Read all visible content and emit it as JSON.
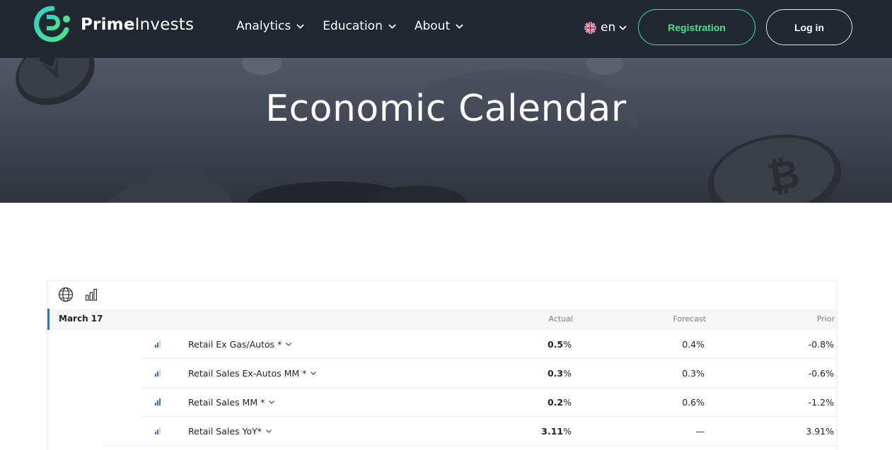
{
  "header": {
    "brand_bold": "Prime",
    "brand_rest": "Invests",
    "logo_icon": "prime-invests-logo",
    "nav": [
      {
        "label": "Analytics"
      },
      {
        "label": "Education"
      },
      {
        "label": "About"
      }
    ],
    "language": {
      "code": "en",
      "flag_icon": "uk-flag-icon"
    },
    "registration_label": "Registration",
    "login_label": "Log in"
  },
  "hero": {
    "title": "Economic Calendar"
  },
  "calendar": {
    "toolbar_icons": [
      "globe-icon",
      "bar-chart-icon"
    ],
    "date": "March 17",
    "columns": {
      "actual": "Actual",
      "forecast": "Forecast",
      "prior": "Prior"
    },
    "events": [
      {
        "name": "Retail Ex Gas/Autos *",
        "importance": 2,
        "actual": "0.5",
        "actual_unit": "%",
        "forecast": "0.4%",
        "prior": "-0.8%"
      },
      {
        "name": "Retail Sales Ex-Autos MM *",
        "importance": 2,
        "actual": "0.3",
        "actual_unit": "%",
        "forecast": "0.3%",
        "prior": "-0.6%"
      },
      {
        "name": "Retail Sales MM *",
        "importance": 3,
        "actual": "0.2",
        "actual_unit": "%",
        "forecast": "0.6%",
        "prior": "-1.2%"
      },
      {
        "name": "Retail Sales YoY*",
        "importance": 2,
        "actual": "3.11",
        "actual_unit": "%",
        "forecast": "—",
        "prior": "3.91%"
      }
    ]
  },
  "colors": {
    "header_bg": "#222831",
    "accent_green": "#46e38c",
    "importance_blue": "#3b6fcf",
    "date_marker": "#2f6fd8"
  }
}
